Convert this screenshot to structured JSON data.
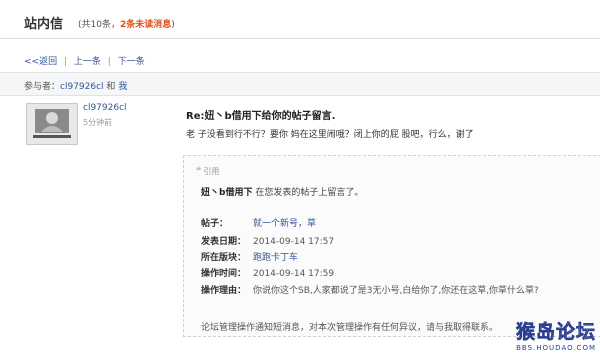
{
  "header": {
    "title": "站内信",
    "count_prefix": "(共10条，",
    "unread": "2条未读消息",
    "count_suffix": ")"
  },
  "nav": {
    "back": "<<返回",
    "prev": "上一条",
    "next": "下一条",
    "sep": "|"
  },
  "participants": {
    "label": "参与者：",
    "user1": "cl97926cl",
    "and": "和",
    "user2": "我"
  },
  "message": {
    "sender": "cl97926cl",
    "time_ago": "5分钟前",
    "title": "Re:妞丶b借用下给你的帖子留言.",
    "body": "老 子没看到行不行？要你 妈在这里闹哦？闭上你的屁 股吧，行么，谢了"
  },
  "quote": {
    "label": "引用",
    "head_user": "妞丶b借用下",
    "head_text": " 在您发表的帖子上留言了。",
    "fields": {
      "post_label": "帖子：",
      "post_value": "就一个新号，草",
      "date_label": "发表日期：",
      "date_value": "2014-09-14 17:57",
      "board_label": "所在版块：",
      "board_value": "跑跑卡丁车",
      "optime_label": "操作时间：",
      "optime_value": "2014-09-14 17:59",
      "reason_label": "操作理由：",
      "reason_value": "你说你这个SB,人家都说了是3无小号,白给你了,你还在这草,你草什么草?"
    },
    "footnote": "论坛管理操作通知短消息，对本次管理操作有任何异议，请与我取得联系。"
  },
  "watermark": {
    "main": "猴岛论坛",
    "sub": "BBS.HOUDAO.COM"
  }
}
